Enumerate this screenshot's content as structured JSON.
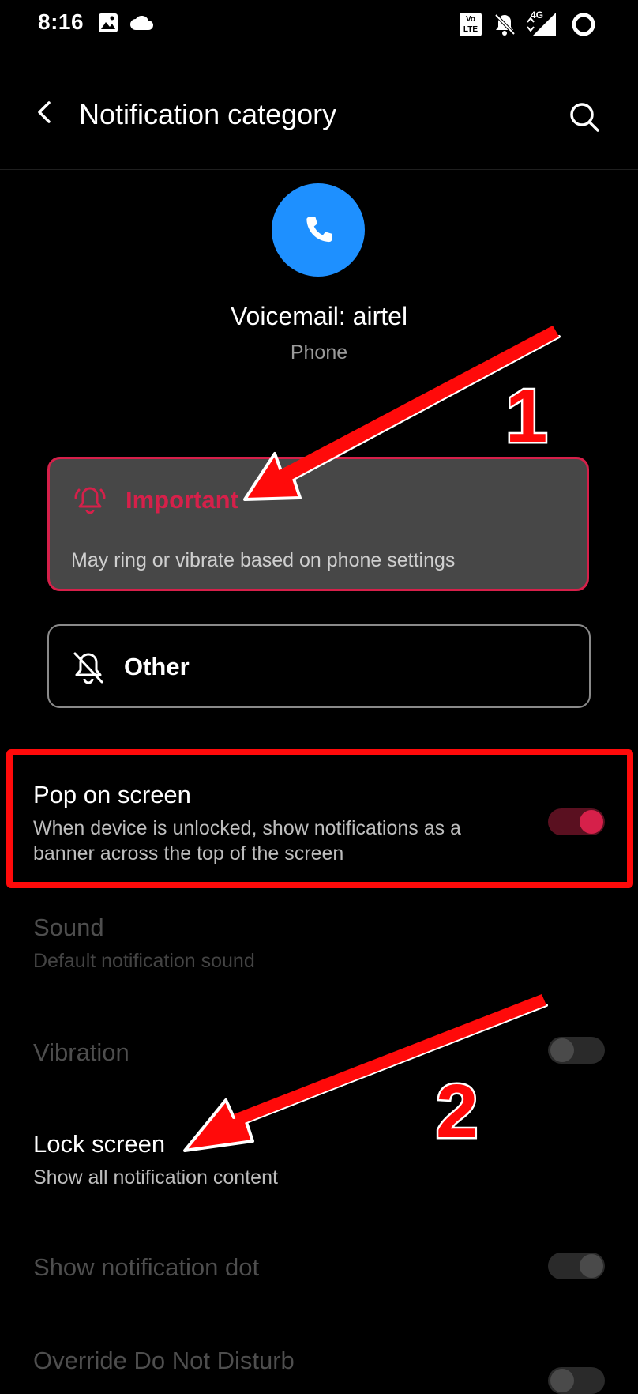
{
  "status_bar": {
    "time": "8:16",
    "left_icons": [
      "image-icon",
      "cloud-icon"
    ],
    "right_icons": [
      "volte-icon",
      "bell-off-icon",
      "signal-4g-icon",
      "battery-ring-icon"
    ],
    "network": "4G",
    "volte_label": "Vo LTE"
  },
  "header": {
    "title": "Notification category"
  },
  "app": {
    "channel_name": "Voicemail: airtel",
    "app_name": "Phone",
    "avatar_color": "#1e90ff"
  },
  "importance": {
    "important": {
      "label": "Important",
      "description": "May ring or vibrate based on phone settings",
      "selected": true
    },
    "other": {
      "label": "Other",
      "selected": false
    }
  },
  "settings": {
    "pop_on_screen": {
      "title": "Pop on screen",
      "subtitle_line1": "When device is unlocked, show notifications as a",
      "subtitle_line2": "banner across the top of the screen",
      "enabled": true
    },
    "sound": {
      "title": "Sound",
      "subtitle": "Default notification sound"
    },
    "vibration": {
      "title": "Vibration",
      "enabled": false
    },
    "lock_screen": {
      "title": "Lock screen",
      "subtitle": "Show all notification content"
    },
    "notification_dot": {
      "title": "Show notification dot",
      "enabled": false
    },
    "override_dnd": {
      "title": "Override Do Not Disturb",
      "enabled": false
    }
  },
  "annotations": {
    "step1": "1",
    "step2": "2"
  },
  "colors": {
    "accent": "#d6204a",
    "background": "#000000",
    "annotation_red": "#ff0a0a"
  }
}
